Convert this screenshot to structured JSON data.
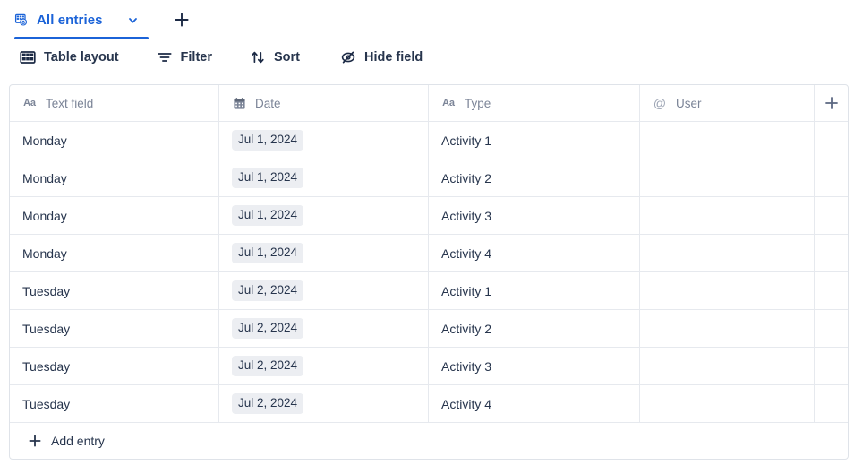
{
  "tabs": {
    "active": {
      "label": "All entries",
      "icon": "table-home-icon",
      "caret_icon": "chevron-down-icon"
    },
    "add_tab_icon": "plus-icon"
  },
  "toolbar": {
    "items": [
      {
        "label": "Table layout",
        "icon": "grid-icon"
      },
      {
        "label": "Filter",
        "icon": "filter-icon"
      },
      {
        "label": "Sort",
        "icon": "sort-arrows-icon"
      },
      {
        "label": "Hide field",
        "icon": "eye-off-icon"
      }
    ]
  },
  "table": {
    "columns": [
      {
        "label": "Text field",
        "icon": "text-field-icon",
        "glyph": "Aa"
      },
      {
        "label": "Date",
        "icon": "calendar-icon",
        "glyph": ""
      },
      {
        "label": "Type",
        "icon": "text-field-icon",
        "glyph": "Aa"
      },
      {
        "label": "User",
        "icon": "at-icon",
        "glyph": "@"
      }
    ],
    "add_column_icon": "plus-icon",
    "rows": [
      {
        "text": "Monday",
        "date": "Jul 1, 2024",
        "type": "Activity 1",
        "user": ""
      },
      {
        "text": "Monday",
        "date": "Jul 1, 2024",
        "type": "Activity 2",
        "user": ""
      },
      {
        "text": "Monday",
        "date": "Jul 1, 2024",
        "type": "Activity 3",
        "user": ""
      },
      {
        "text": "Monday",
        "date": "Jul 1, 2024",
        "type": "Activity 4",
        "user": ""
      },
      {
        "text": "Tuesday",
        "date": "Jul 2, 2024",
        "type": "Activity 1",
        "user": ""
      },
      {
        "text": "Tuesday",
        "date": "Jul 2, 2024",
        "type": "Activity 2",
        "user": ""
      },
      {
        "text": "Tuesday",
        "date": "Jul 2, 2024",
        "type": "Activity 3",
        "user": ""
      },
      {
        "text": "Tuesday",
        "date": "Jul 2, 2024",
        "type": "Activity 4",
        "user": ""
      }
    ],
    "add_entry": {
      "label": "Add entry",
      "icon": "plus-icon"
    }
  },
  "colors": {
    "accent": "#1b63d8",
    "text": "#27354d",
    "muted": "#7b8497",
    "border": "#e6e9ee",
    "pill": "#eceef2"
  }
}
